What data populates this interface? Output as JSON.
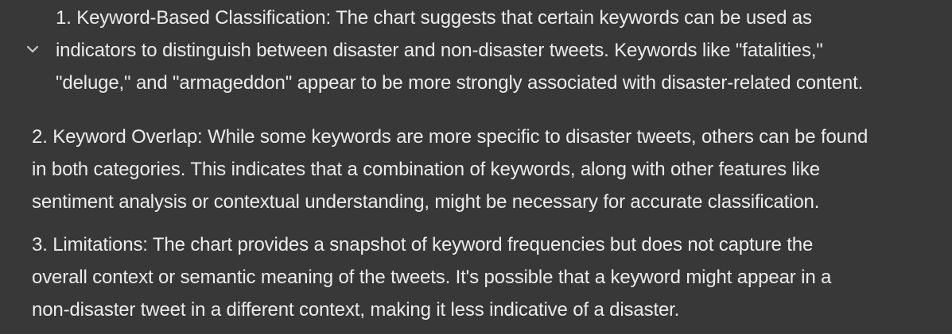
{
  "collapse_toggle": {
    "icon": "chevron-down-icon"
  },
  "points": [
    {
      "text": "1. Keyword-Based Classification: The chart suggests that certain keywords can be used as\nindicators to distinguish between disaster and non-disaster tweets. Keywords like \"fatalities,\"\n\"deluge,\" and \"armageddon\" appear to be more strongly associated with disaster-related content."
    },
    {
      "text": "2. Keyword Overlap: While some keywords are more specific to disaster tweets, others can be found\nin both categories. This indicates that a combination of keywords, along with other features like\nsentiment analysis or contextual understanding, might be necessary for accurate classification."
    },
    {
      "text": "3. Limitations: The chart provides a snapshot of keyword frequencies but does not capture the\noverall context or semantic meaning of the tweets. It's possible that a keyword might appear in a\nnon-disaster tweet in a different context, making it less indicative of a disaster."
    }
  ],
  "colors": {
    "background": "#383838",
    "text": "#ececec",
    "icon": "#c8c8c8"
  }
}
